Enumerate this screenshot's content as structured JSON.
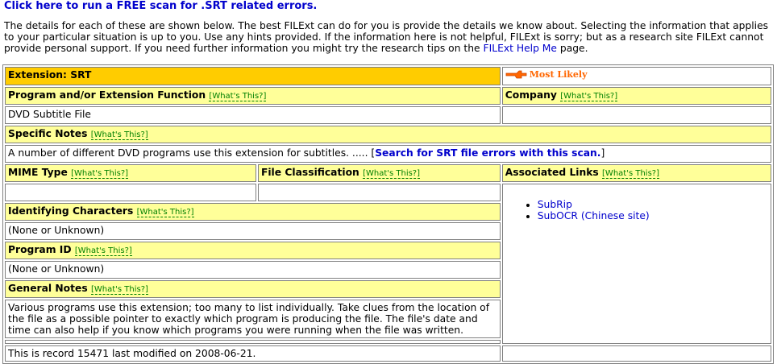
{
  "scan_link": "Click here to run a FREE scan for .SRT related errors.",
  "intro": {
    "text": "The details for each of these are shown below. The best FILExt can do for you is provide the details we know about. Selecting the information that applies to your particular situation is up to you. Use any hints provided. If the information here is not helpful, FILExt is sorry; but as a research site FILExt cannot provide personal support. If you need further information you might try the research tips on the",
    "help_link": "FILExt Help Me",
    "suffix": "page."
  },
  "whats_this": "[What's This?]",
  "extension": {
    "label": "Extension: SRT",
    "badge": "Most Likely"
  },
  "program": {
    "label": "Program and/or Extension Function",
    "value": "DVD Subtitle File"
  },
  "company": {
    "label": "Company",
    "value": ""
  },
  "specific_notes": {
    "label": "Specific Notes",
    "text": "A number of different DVD programs use this extension for subtitles. .....",
    "link": "Search for SRT file errors with this scan."
  },
  "mime": {
    "label": "MIME Type",
    "value": ""
  },
  "classification": {
    "label": "File Classification",
    "value": ""
  },
  "associated_links": {
    "label": "Associated Links",
    "items": [
      "SubRip",
      "SubOCR (Chinese site)"
    ]
  },
  "identifying": {
    "label": "Identifying Characters",
    "value": "(None or Unknown)"
  },
  "program_id": {
    "label": "Program ID",
    "value": "(None or Unknown)"
  },
  "general_notes": {
    "label": "General Notes",
    "text": "Various programs use this extension; too many to list individually. Take clues from the location of the file as a possible pointer to exactly which program is producing the file. The file's date and time can also help if you know which programs you were running when the file was written."
  },
  "footer": "This is record 15471 last modified on 2008-06-21.",
  "colors": {
    "header_bg": "#ffff99",
    "extension_bg": "#ffcc00",
    "link": "#0000cc",
    "whats_this": "#008000",
    "badge": "#ff6600"
  }
}
